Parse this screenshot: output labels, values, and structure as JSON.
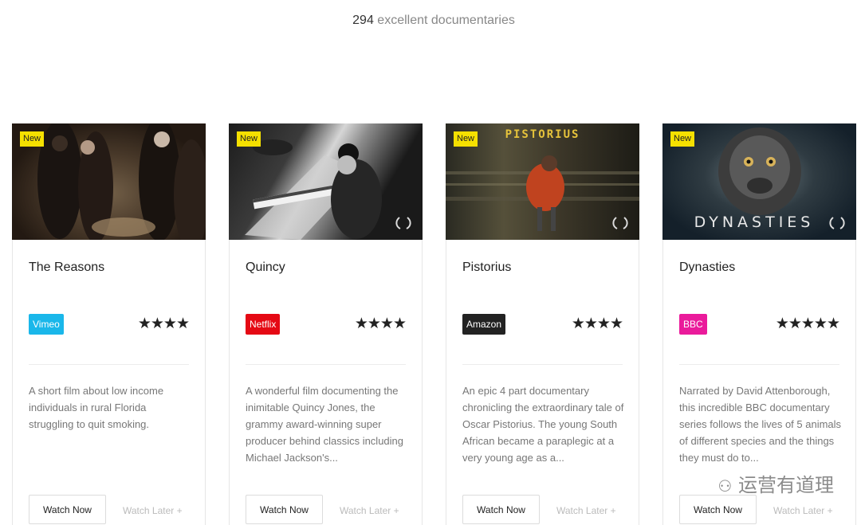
{
  "header": {
    "count": "294",
    "label": "excellent documentaries"
  },
  "cards": [
    {
      "badge": "New",
      "title": "The Reasons",
      "provider": "Vimeo",
      "provider_color": "#1ab7ea",
      "stars": "★★★★",
      "rating": 4,
      "description": "A short film about low income individuals in rural Florida struggling to quit smoking.",
      "watch_now": "Watch Now",
      "watch_later": "Watch Later +"
    },
    {
      "badge": "New",
      "title": "Quincy",
      "provider": "Netflix",
      "provider_color": "#e50914",
      "stars": "★★★★",
      "rating": 4,
      "description": "A wonderful film documenting the inimitable Quincy Jones, the grammy award-winning super producer behind classics including Michael Jackson's...",
      "watch_now": "Watch Now",
      "watch_later": "Watch Later +"
    },
    {
      "badge": "New",
      "title": "Pistorius",
      "thumb_text": "PISTORIUS",
      "provider": "Amazon",
      "provider_color": "#222222",
      "stars": "★★★★",
      "rating": 4,
      "description": "An epic 4 part documentary chronicling the extraordinary tale of Oscar Pistorius. The young South African became a paraplegic at a very young age as a...",
      "watch_now": "Watch Now",
      "watch_later": "Watch Later +"
    },
    {
      "badge": "New",
      "title": "Dynasties",
      "thumb_text": "DYNASTIES",
      "provider": "BBC",
      "provider_color": "#ea1b9b",
      "stars": "★★★★★",
      "rating": 5,
      "description": "Narrated by David Attenborough, this incredible BBC documentary series follows the lives of 5 animals of different species and the things they must do to...",
      "watch_now": "Watch Now",
      "watch_later": "Watch Later +"
    }
  ],
  "watermark": "运营有道理"
}
